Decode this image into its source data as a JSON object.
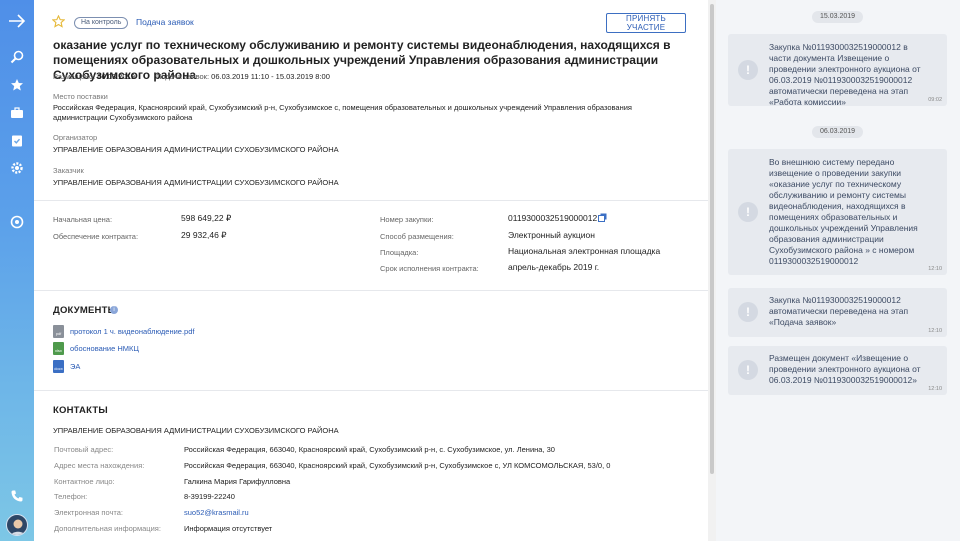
{
  "header": {
    "badge": "На контроль",
    "stage": "Подача заявок",
    "participate_button": "ПРИНЯТЬ УЧАСТИЕ"
  },
  "title": "оказание услуг по техническому обслуживанию и ремонту системы видеонаблюдения, находящихся в помещениях образовательных и дошкольных учреждений Управления образования администрации Сухобузимского района",
  "meta": {
    "published_label": "Размещено:",
    "published_value": "06.03.2019",
    "submission_label": "Подача заявок:",
    "submission_value": "06.03.2019 11:10 - 15.03.2019 8:00"
  },
  "delivery": {
    "label": "Место поставки",
    "value_line1": "Российская Федерация, Красноярский край, Сухобузимский р-н, Сухобузимское с, помещения образовательных и дошкольных учреждений Управления образования",
    "value_line2": "администрации Сухобузимского района"
  },
  "organizer": {
    "label": "Организатор",
    "value": "УПРАВЛЕНИЕ ОБРАЗОВАНИЯ АДМИНИСТРАЦИИ СУХОБУЗИМСКОГО РАЙОНА"
  },
  "customer": {
    "label": "Заказчик",
    "value": "УПРАВЛЕНИЕ ОБРАЗОВАНИЯ АДМИНИСТРАЦИИ СУХОБУЗИМСКОГО РАЙОНА"
  },
  "details": {
    "start_price_label": "Начальная цена:",
    "start_price_value": "598 649,22 ₽",
    "security_label": "Обеспечение контракта:",
    "security_value": "29 932,46 ₽",
    "number_label": "Номер закупки:",
    "number_value": "0119300032519000012",
    "method_label": "Способ размещения:",
    "method_value": "Электронный аукцион",
    "platform_label": "Площадка:",
    "platform_value": "Национальная электронная площадка",
    "term_label": "Срок исполнения контракта:",
    "term_value": "апрель-декабрь 2019 г."
  },
  "documents": {
    "heading": "ДОКУМЕНТЫ",
    "items": [
      {
        "name": "протокол 1 ч. видеонаблюдение.pdf",
        "ext": "pdf",
        "color": "#8a9099"
      },
      {
        "name": "обоснование НМКЦ",
        "ext": "xlsx",
        "color": "#4f9a4c"
      },
      {
        "name": "ЭА",
        "ext": "docx",
        "color": "#3b6fc4"
      }
    ]
  },
  "contacts": {
    "heading": "КОНТАКТЫ",
    "org": "УПРАВЛЕНИЕ ОБРАЗОВАНИЯ АДМИНИСТРАЦИИ СУХОБУЗИМСКОГО РАЙОНА",
    "rows": [
      {
        "label": "Почтовый адрес:",
        "value": "Российская Федерация, 663040, Красноярский край, Сухобузимский р-н, с. Сухобузимское, ул. Ленина, 30"
      },
      {
        "label": "Адрес места нахождения:",
        "value": "Российская Федерация, 663040, Красноярский край, Сухобузимский р-н, Сухобузимское с, УЛ КОМСОМОЛЬСКАЯ, 53/0, 0"
      },
      {
        "label": "Контактное лицо:",
        "value": "Галкина Мария Гарифулловна"
      },
      {
        "label": "Телефон:",
        "value": "8-39199-22240"
      },
      {
        "label": "Электронная почта:",
        "value": "suo52@krasmail.ru"
      },
      {
        "label": "Дополнительная информация:",
        "value": "Информация отсутствует"
      }
    ]
  },
  "feed": {
    "date1": "15.03.2019",
    "date2": "06.03.2019",
    "messages": [
      {
        "text": "Закупка №0119300032519000012 в части документа Извещение о проведении электронного аукциона от 06.03.2019 №0119300032519000012 автоматически переведена на этап «Работа комиссии»",
        "time": "09:02"
      },
      {
        "text": "Во внешнюю систему передано извещение о проведении закупки «оказание услуг по техническому обслуживанию и ремонту системы видеонаблюдения, находящихся в помещениях образовательных и дошкольных учреждений Управления образования администрации Сухобузимского района » с номером 0119300032519000012",
        "time": "12:10"
      },
      {
        "text": "Закупка №0119300032519000012 автоматически переведена на этап «Подача заявок»",
        "time": "12:10"
      },
      {
        "text": "Размещен документ «Извещение о проведении электронного аукциона от 06.03.2019 №0119300032519000012»",
        "time": "12:10"
      }
    ]
  }
}
